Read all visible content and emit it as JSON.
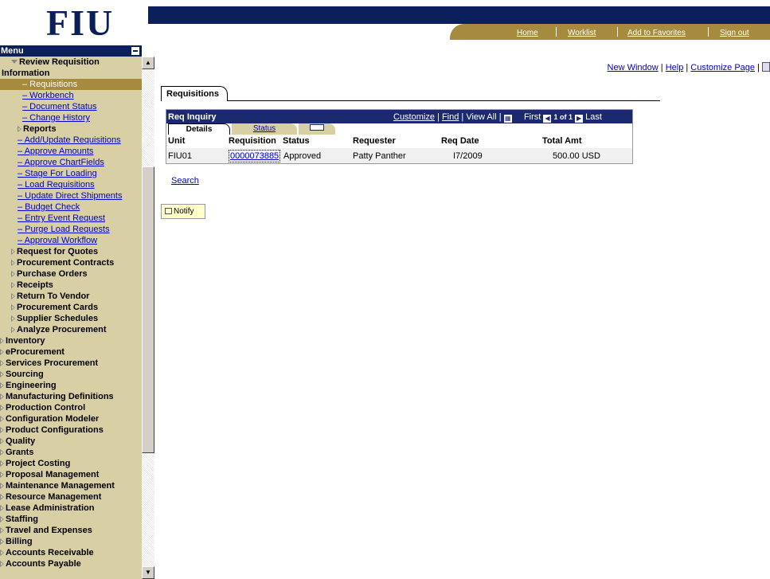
{
  "logo": {
    "text": "FIU"
  },
  "menu": {
    "title": "Menu",
    "items": [
      {
        "label": "Review Requisition",
        "indent": 14,
        "style": "b",
        "icon": "down"
      },
      {
        "label": "Information",
        "indent": 2,
        "style": "b"
      },
      {
        "label": "– Requisitions",
        "indent": 28,
        "style": "sel"
      },
      {
        "label": "– Workbench",
        "indent": 28,
        "style": "l"
      },
      {
        "label": "– Document Status",
        "indent": 28,
        "style": "l"
      },
      {
        "label": "– Change History",
        "indent": 28,
        "style": "l"
      },
      {
        "label": "Reports",
        "indent": 22,
        "style": "b",
        "icon": "right"
      },
      {
        "label": "– Add/Update Requisitions",
        "indent": 22,
        "style": "l"
      },
      {
        "label": "– Approve Amounts",
        "indent": 22,
        "style": "l"
      },
      {
        "label": "– Approve ChartFields",
        "indent": 22,
        "style": "l"
      },
      {
        "label": "– Stage For Loading",
        "indent": 22,
        "style": "l"
      },
      {
        "label": "– Load Requisitions",
        "indent": 22,
        "style": "l"
      },
      {
        "label": "– Update Direct Shipments",
        "indent": 22,
        "style": "l"
      },
      {
        "label": "– Budget Check",
        "indent": 22,
        "style": "l"
      },
      {
        "label": "– Entry Event Request",
        "indent": 22,
        "style": "l"
      },
      {
        "label": "– Purge Load Requests",
        "indent": 22,
        "style": "l"
      },
      {
        "label": "– Approval Workflow",
        "indent": 22,
        "style": "l"
      },
      {
        "label": "Request for Quotes",
        "indent": 14,
        "style": "b",
        "icon": "right"
      },
      {
        "label": "Procurement Contracts",
        "indent": 14,
        "style": "b",
        "icon": "right"
      },
      {
        "label": "Purchase Orders",
        "indent": 14,
        "style": "b",
        "icon": "right"
      },
      {
        "label": "Receipts",
        "indent": 14,
        "style": "b",
        "icon": "right"
      },
      {
        "label": "Return To Vendor",
        "indent": 14,
        "style": "b",
        "icon": "right"
      },
      {
        "label": "Procurement Cards",
        "indent": 14,
        "style": "b",
        "icon": "right"
      },
      {
        "label": "Supplier Schedules",
        "indent": 14,
        "style": "b",
        "icon": "right"
      },
      {
        "label": "Analyze Procurement",
        "indent": 14,
        "style": "b",
        "icon": "right"
      },
      {
        "label": "Inventory",
        "indent": 0,
        "style": "b",
        "icon": "right"
      },
      {
        "label": "eProcurement",
        "indent": 0,
        "style": "b",
        "icon": "right"
      },
      {
        "label": "Services Procurement",
        "indent": 0,
        "style": "b",
        "icon": "right"
      },
      {
        "label": "Sourcing",
        "indent": 0,
        "style": "b",
        "icon": "right"
      },
      {
        "label": "Engineering",
        "indent": 0,
        "style": "b",
        "icon": "right"
      },
      {
        "label": "Manufacturing Definitions",
        "indent": 0,
        "style": "b",
        "icon": "right"
      },
      {
        "label": "Production Control",
        "indent": 0,
        "style": "b",
        "icon": "right"
      },
      {
        "label": "Configuration Modeler",
        "indent": 0,
        "style": "b",
        "icon": "right"
      },
      {
        "label": "Product Configurations",
        "indent": 0,
        "style": "b",
        "icon": "right"
      },
      {
        "label": "Quality",
        "indent": 0,
        "style": "b",
        "icon": "right"
      },
      {
        "label": "Grants",
        "indent": 0,
        "style": "b",
        "icon": "right"
      },
      {
        "label": "Project Costing",
        "indent": 0,
        "style": "b",
        "icon": "right"
      },
      {
        "label": "Proposal Management",
        "indent": 0,
        "style": "b",
        "icon": "right"
      },
      {
        "label": "Maintenance Management",
        "indent": 0,
        "style": "b",
        "icon": "right"
      },
      {
        "label": "Resource Management",
        "indent": 0,
        "style": "b",
        "icon": "right"
      },
      {
        "label": "Lease Administration",
        "indent": 0,
        "style": "b",
        "icon": "right"
      },
      {
        "label": "Staffing",
        "indent": 0,
        "style": "b",
        "icon": "right"
      },
      {
        "label": "Travel and Expenses",
        "indent": 0,
        "style": "b",
        "icon": "right"
      },
      {
        "label": "Billing",
        "indent": 0,
        "style": "b",
        "icon": "right"
      },
      {
        "label": "Accounts Receivable",
        "indent": 0,
        "style": "b",
        "icon": "right"
      },
      {
        "label": "Accounts Payable",
        "indent": 0,
        "style": "b",
        "icon": "right"
      }
    ]
  },
  "nav": {
    "home": "Home",
    "worklist": "Worklist",
    "favorites": "Add to Favorites",
    "signout": "Sign out"
  },
  "toplinks": {
    "new_window": "New Window",
    "sep": " | ",
    "help": "Help",
    "customize": "Customize Page"
  },
  "page": {
    "tab": "Requisitions"
  },
  "grid": {
    "title": "Req Inquiry",
    "customize": "Customize",
    "find": "Find",
    "view_all": "View All",
    "first": "First",
    "range": "1 of 1",
    "last": "Last",
    "tab_details": "Details",
    "tab_status": "Status",
    "columns": {
      "unit": "Unit",
      "requisition": "Requisition",
      "status": "Status",
      "requester": "Requester",
      "req_date": "Req Date",
      "total_amt": "Total Amt"
    },
    "row": {
      "unit": "FIU01",
      "requisition": "0000073885",
      "status": "Approved",
      "requester": "Patty Panther",
      "req_date": "I7/2009",
      "total_amt": "500.00 USD"
    }
  },
  "search_link": "Search",
  "notify_button": "Notify",
  "colors": {
    "navy": "#0b1f5c",
    "gold": "#a68a3e",
    "menu_bg": "#d9cfa4"
  }
}
